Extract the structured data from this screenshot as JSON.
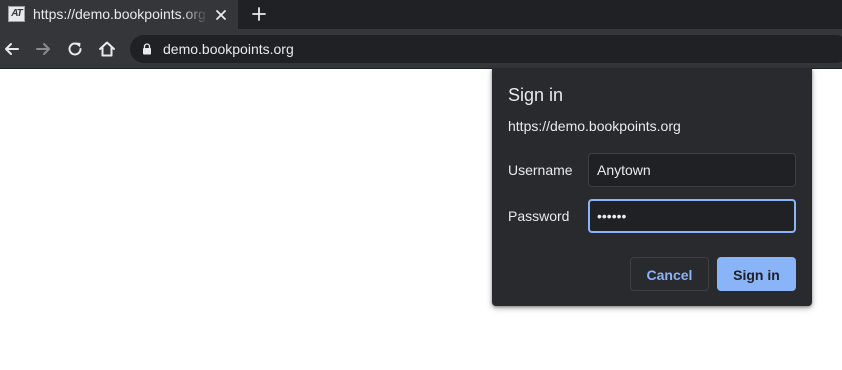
{
  "tab": {
    "title": "https://demo.bookpoints.org",
    "favicon_text": "AT",
    "close_icon": "close-icon"
  },
  "new_tab_icon": "plus-icon",
  "toolbar": {
    "back_icon": "arrow-left-icon",
    "forward_icon": "arrow-right-icon",
    "reload_icon": "reload-icon",
    "home_icon": "home-icon",
    "lock_icon": "lock-icon",
    "url": "demo.bookpoints.org"
  },
  "dialog": {
    "title": "Sign in",
    "origin": "https://demo.bookpoints.org",
    "username_label": "Username",
    "username_value": "Anytown",
    "password_label": "Password",
    "password_value": "••••••",
    "cancel_label": "Cancel",
    "signin_label": "Sign in"
  },
  "colors": {
    "frame": "#202124",
    "toolbar": "#35363a",
    "dialog": "#292a2d",
    "accent": "#8ab4f8",
    "text": "#e8eaed"
  }
}
